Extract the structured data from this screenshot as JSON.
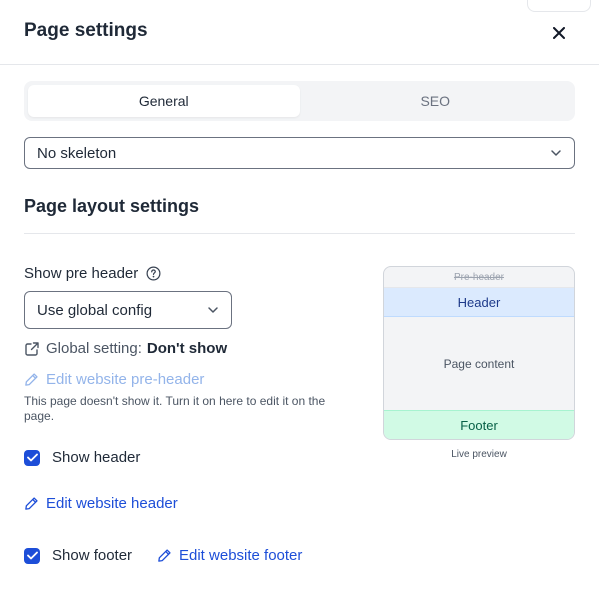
{
  "panel": {
    "title": "Page settings"
  },
  "tabs": [
    {
      "label": "General",
      "active": true
    },
    {
      "label": "SEO",
      "active": false
    }
  ],
  "skeleton_select": {
    "value": "No skeleton"
  },
  "layout": {
    "section_title": "Page layout settings",
    "pre_header": {
      "label": "Show pre header",
      "select_value": "Use global config",
      "global_setting_label": "Global setting:",
      "global_setting_value": "Don't show",
      "edit_link": "Edit website pre-header",
      "note": "This page doesn't show it. Turn it on here to edit it on the page."
    },
    "header": {
      "label": "Show header",
      "checked": true,
      "edit_link": "Edit website header"
    },
    "footer": {
      "label": "Show footer",
      "checked": true,
      "edit_link": "Edit website footer"
    }
  },
  "preview": {
    "pre_header": "Pre-header",
    "header": "Header",
    "content": "Page content",
    "footer": "Footer",
    "caption": "Live preview"
  },
  "colors": {
    "accent": "#1d4ed8",
    "header_fill": "#dbeafe",
    "footer_fill": "#d1fae5"
  },
  "icons": {
    "close": "close-icon",
    "chevron": "chevron-down-icon",
    "help": "help-circle-icon",
    "external": "external-link-icon",
    "edit": "pencil-icon",
    "check": "checkmark-icon"
  }
}
